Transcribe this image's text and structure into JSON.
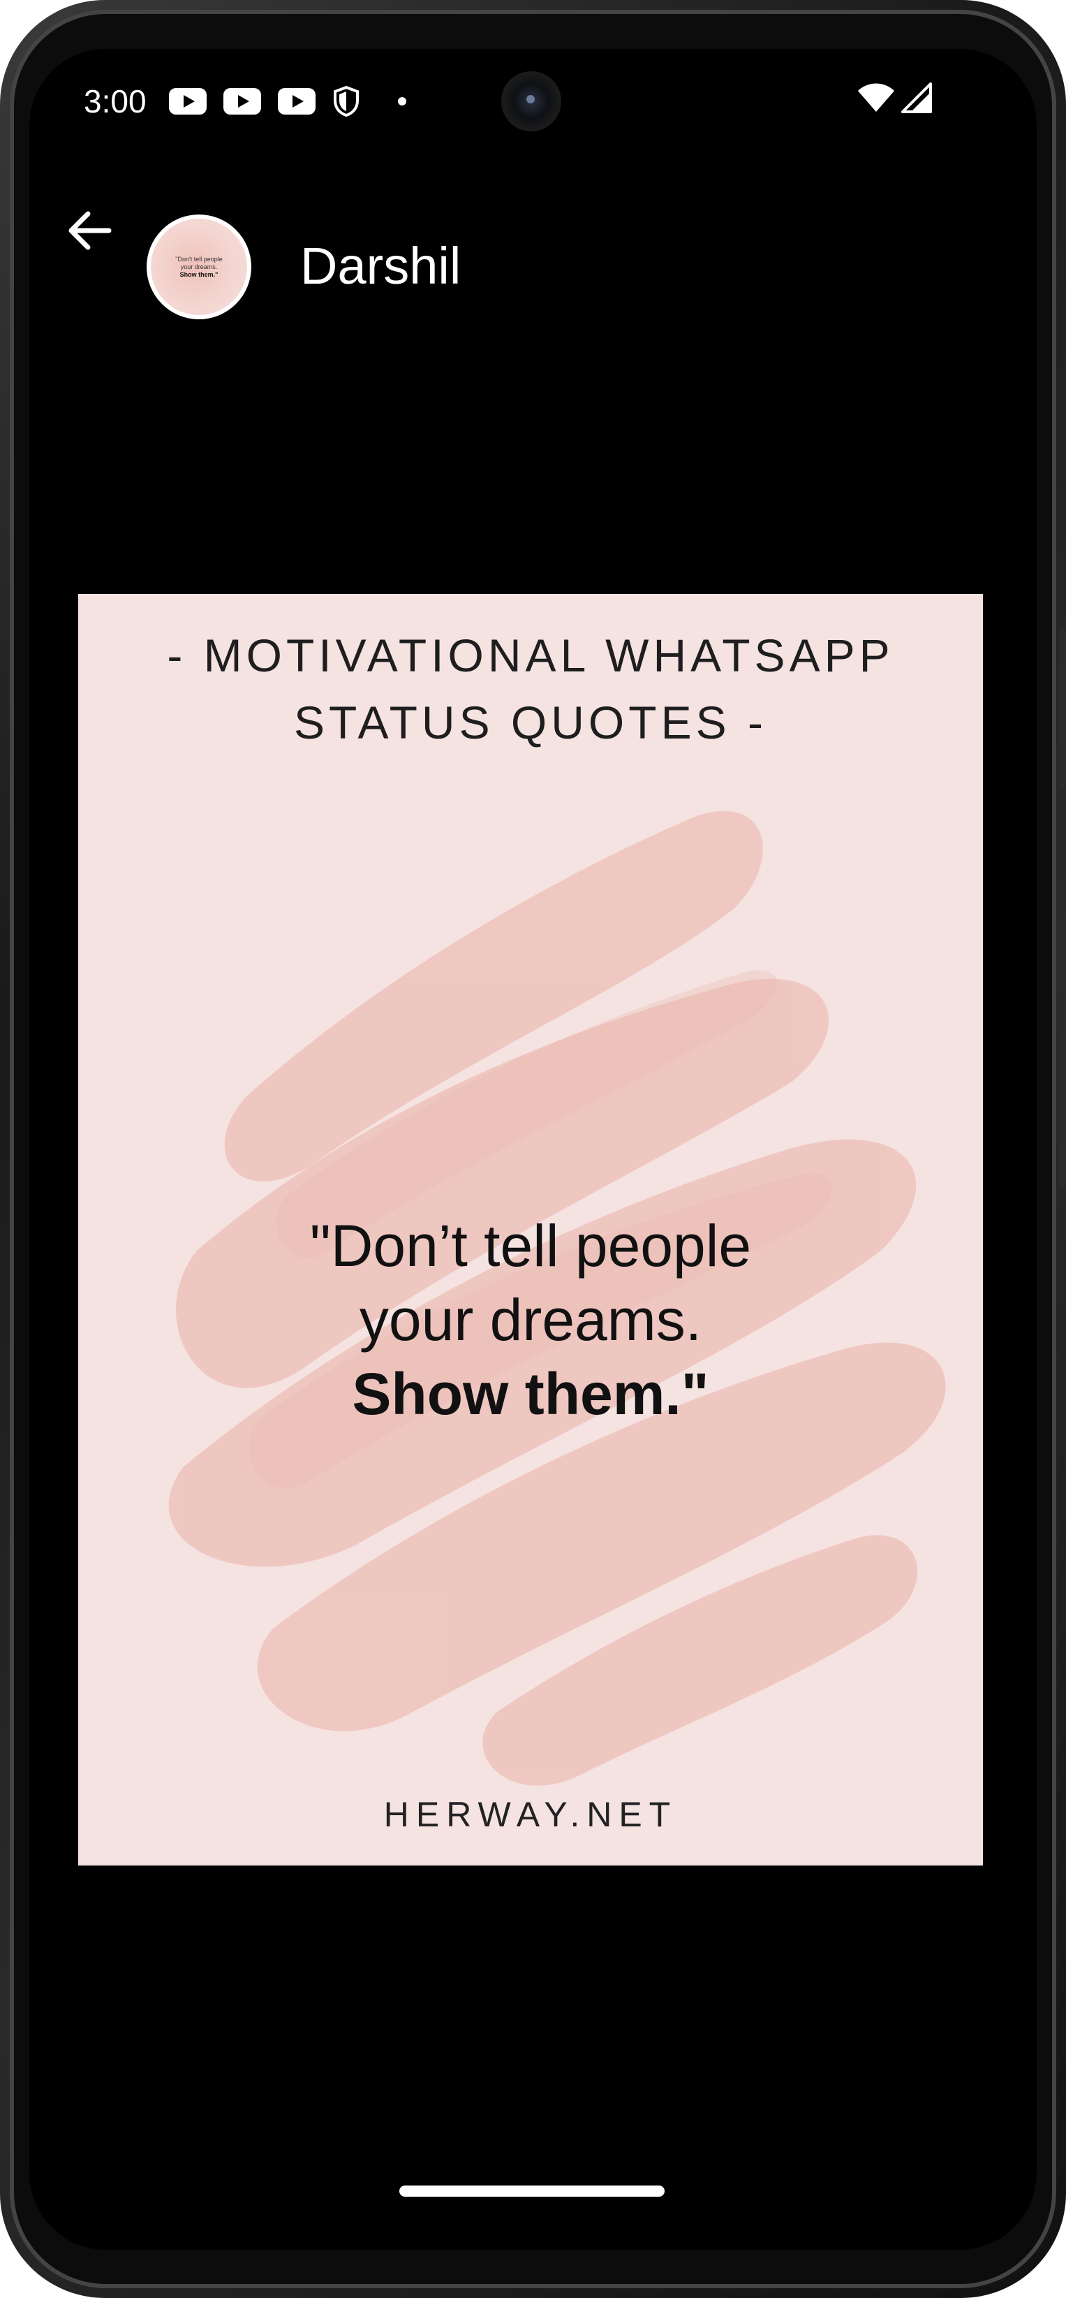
{
  "status_bar": {
    "time": "3:00",
    "icons": [
      "youtube-icon",
      "youtube-icon",
      "youtube-icon",
      "shield-icon",
      "dot-icon",
      "wifi-icon",
      "signal-icon"
    ]
  },
  "header": {
    "back_icon": "arrow-left-icon",
    "contact_name": "Darshil",
    "avatar_lines": [
      "\"Don't tell people",
      "your dreams.",
      "Show them.\""
    ]
  },
  "status_image": {
    "title_line1": "- MOTIVATIONAL WHATSAPP",
    "title_line2": "STATUS QUOTES -",
    "quote_line1": "\"Don’t tell people",
    "quote_line2": "your dreams.",
    "quote_line3": "Show them.\"",
    "footer": "HERWAY.NET",
    "background_color": "#f5e3e2",
    "brush_color": "#efc3bc"
  }
}
